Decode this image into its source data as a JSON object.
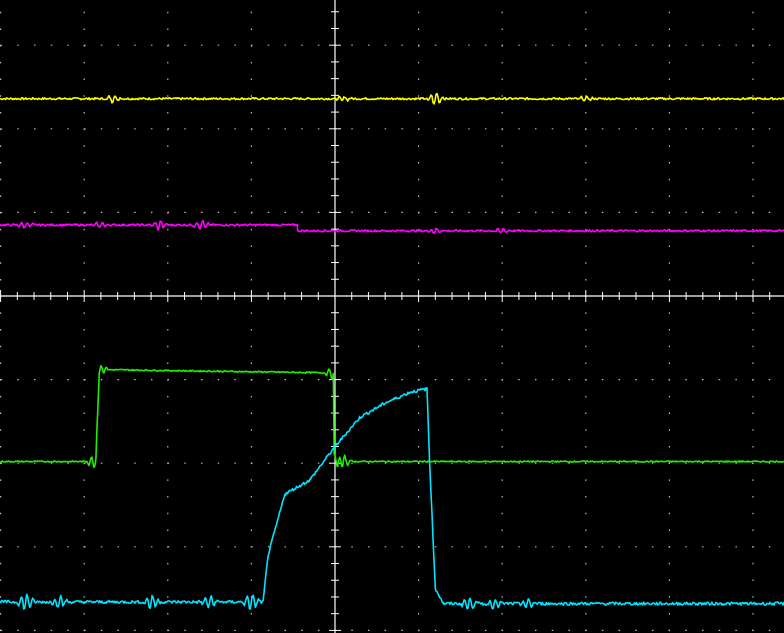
{
  "chart_data": {
    "type": "line",
    "title": "",
    "xlabel": "",
    "ylabel": "",
    "grid": true,
    "grid_style": "dotted",
    "background": "#000000",
    "axis_color": "#ffffff",
    "grid_color": "#bbbbbb",
    "xlim": [
      -4,
      5.4
    ],
    "ylim": [
      -4,
      3.55
    ],
    "x_divisions": 10,
    "y_divisions": 8,
    "series": [
      {
        "color": "#ffff00",
        "noise": 0.012,
        "points": [
          [
            -4,
            2.36
          ],
          [
            5.4,
            2.36
          ]
        ],
        "glitches": [
          [
            -2.65,
            0.05
          ],
          [
            0.1,
            0.03
          ],
          [
            1.2,
            0.08
          ],
          [
            3.0,
            0.03
          ]
        ]
      },
      {
        "color": "#ff00ff",
        "noise": 0.012,
        "points": [
          [
            -4,
            0.85
          ],
          [
            -0.45,
            0.85
          ],
          [
            -0.45,
            0.78
          ],
          [
            5.4,
            0.78
          ]
        ],
        "glitches": [
          [
            -3.7,
            0.04
          ],
          [
            -2.8,
            0.04
          ],
          [
            -2.1,
            0.06
          ],
          [
            -1.6,
            0.06
          ],
          [
            1.2,
            0.03
          ],
          [
            2.0,
            0.03
          ]
        ]
      },
      {
        "color": "#22ee00",
        "noise": 0.008,
        "points": [
          [
            -4,
            -1.98
          ],
          [
            -2.86,
            -1.98
          ],
          [
            -2.82,
            -0.88
          ],
          [
            -0.02,
            -0.92
          ],
          [
            -0.01,
            -1.98
          ],
          [
            5.4,
            -1.98
          ]
        ],
        "glitches": [
          [
            -2.86,
            0.14
          ],
          [
            -2.82,
            0.12
          ],
          [
            -0.02,
            0.1
          ],
          [
            0.1,
            0.08
          ]
        ]
      },
      {
        "color": "#00e5ff",
        "noise": 0.018,
        "points": [
          [
            -4,
            -3.66
          ],
          [
            -0.86,
            -3.66
          ],
          [
            -0.8,
            -3.1
          ],
          [
            -0.6,
            -2.37
          ],
          [
            -0.3,
            -2.2
          ],
          [
            0,
            -1.8
          ],
          [
            0.3,
            -1.45
          ],
          [
            0.6,
            -1.28
          ],
          [
            0.9,
            -1.15
          ],
          [
            1.1,
            -1.11
          ],
          [
            1.13,
            -1.95
          ],
          [
            1.2,
            -3.5
          ],
          [
            1.3,
            -3.68
          ],
          [
            5.4,
            -3.68
          ]
        ],
        "glitches": [
          [
            -3.7,
            0.1
          ],
          [
            -3.3,
            0.08
          ],
          [
            -2.2,
            0.09
          ],
          [
            -1.5,
            0.07
          ],
          [
            -1.0,
            0.1
          ],
          [
            1.6,
            0.08
          ],
          [
            1.9,
            0.07
          ],
          [
            2.3,
            0.06
          ]
        ]
      }
    ]
  }
}
